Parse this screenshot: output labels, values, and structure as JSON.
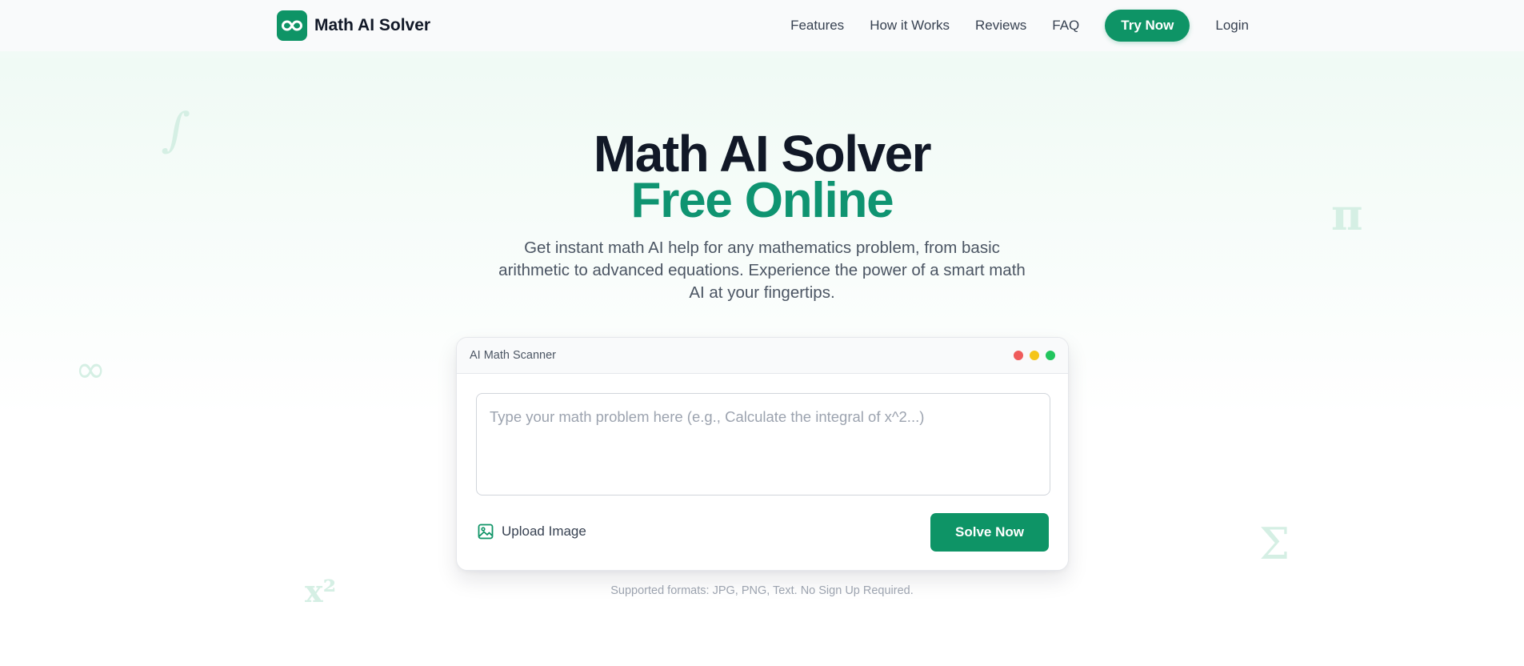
{
  "nav": {
    "brand": "Math AI Solver",
    "links": [
      "Features",
      "How it Works",
      "Reviews",
      "FAQ"
    ],
    "cta": "Try Now",
    "login": "Login"
  },
  "decorations": {
    "integral": "∫",
    "pi": "π",
    "infinity": "∞",
    "sigma": "Σ",
    "x2": "x²"
  },
  "hero": {
    "title": "Math AI Solver",
    "subtitle": "Free Online",
    "description": "Get instant math AI help for any mathematics problem, from basic arithmetic to advanced equations. Experience the power of a smart math AI at your fingertips."
  },
  "scanner": {
    "title": "AI Math Scanner",
    "placeholder": "Type your math problem here (e.g., Calculate the integral of x^2...)",
    "upload_label": "Upload Image",
    "solve_label": "Solve Now",
    "window_dots": [
      "#ef5b5b",
      "#f5c518",
      "#22c55e"
    ]
  },
  "footer_note": "Supported formats: JPG, PNG, Text. No Sign Up Required.",
  "colors": {
    "brand": "#0e9466",
    "accent_text": "#0f9471"
  }
}
